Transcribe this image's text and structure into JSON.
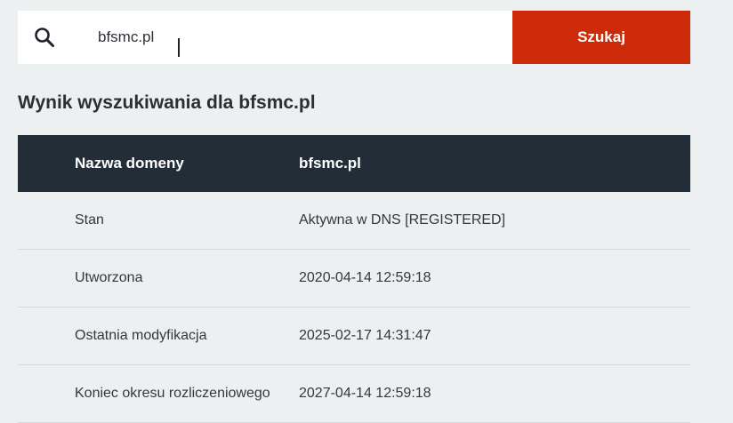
{
  "search": {
    "value": "bfsmc.pl",
    "button_label": "Szukaj"
  },
  "result": {
    "heading": "Wynik wyszukiwania dla bfsmc.pl",
    "header": {
      "key": "Nazwa domeny",
      "value": "bfsmc.pl"
    },
    "rows": [
      {
        "key": "Stan",
        "value": "Aktywna w DNS [REGISTERED]"
      },
      {
        "key": "Utworzona",
        "value": "2020-04-14 12:59:18"
      },
      {
        "key": "Ostatnia modyfikacja",
        "value": "2025-02-17 14:31:47"
      },
      {
        "key": "Koniec okresu rozliczeniowego",
        "value": "2027-04-14 12:59:18"
      }
    ]
  },
  "colors": {
    "accent": "#cc2a08",
    "header_bg": "#222d38",
    "page_bg": "#edf0f1"
  }
}
